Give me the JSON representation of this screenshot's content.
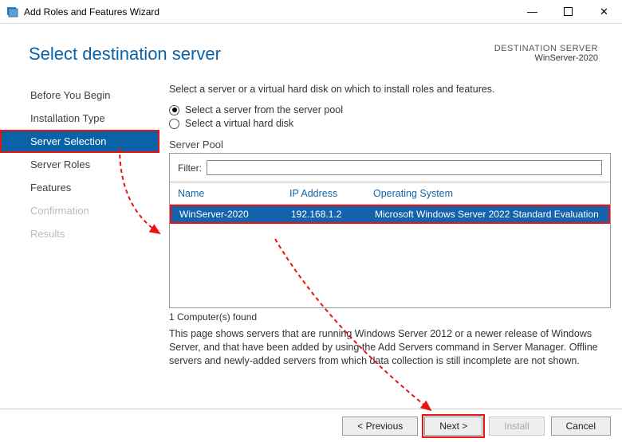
{
  "window": {
    "title": "Add Roles and Features Wizard"
  },
  "header": {
    "title": "Select destination server",
    "meta_label": "DESTINATION SERVER",
    "meta_value": "WinServer-2020"
  },
  "sidebar": {
    "items": [
      {
        "label": "Before You Begin"
      },
      {
        "label": "Installation Type"
      },
      {
        "label": "Server Selection"
      },
      {
        "label": "Server Roles"
      },
      {
        "label": "Features"
      },
      {
        "label": "Confirmation"
      },
      {
        "label": "Results"
      }
    ]
  },
  "main": {
    "instruction": "Select a server or a virtual hard disk on which to install roles and features.",
    "radios": {
      "pool": "Select a server from the server pool",
      "vhd": "Select a virtual hard disk"
    },
    "pool_label": "Server Pool",
    "filter_label": "Filter:",
    "filter_placeholder": "",
    "columns": {
      "name": "Name",
      "ip": "IP Address",
      "os": "Operating System"
    },
    "rows": [
      {
        "name": "WinServer-2020",
        "ip": "192.168.1.2",
        "os": "Microsoft Windows Server 2022 Standard Evaluation"
      }
    ],
    "found": "1 Computer(s) found",
    "note": "This page shows servers that are running Windows Server 2012 or a newer release of Windows Server, and that have been added by using the Add Servers command in Server Manager. Offline servers and newly-added servers from which data collection is still incomplete are not shown."
  },
  "footer": {
    "previous": "< Previous",
    "next": "Next >",
    "install": "Install",
    "cancel": "Cancel"
  }
}
